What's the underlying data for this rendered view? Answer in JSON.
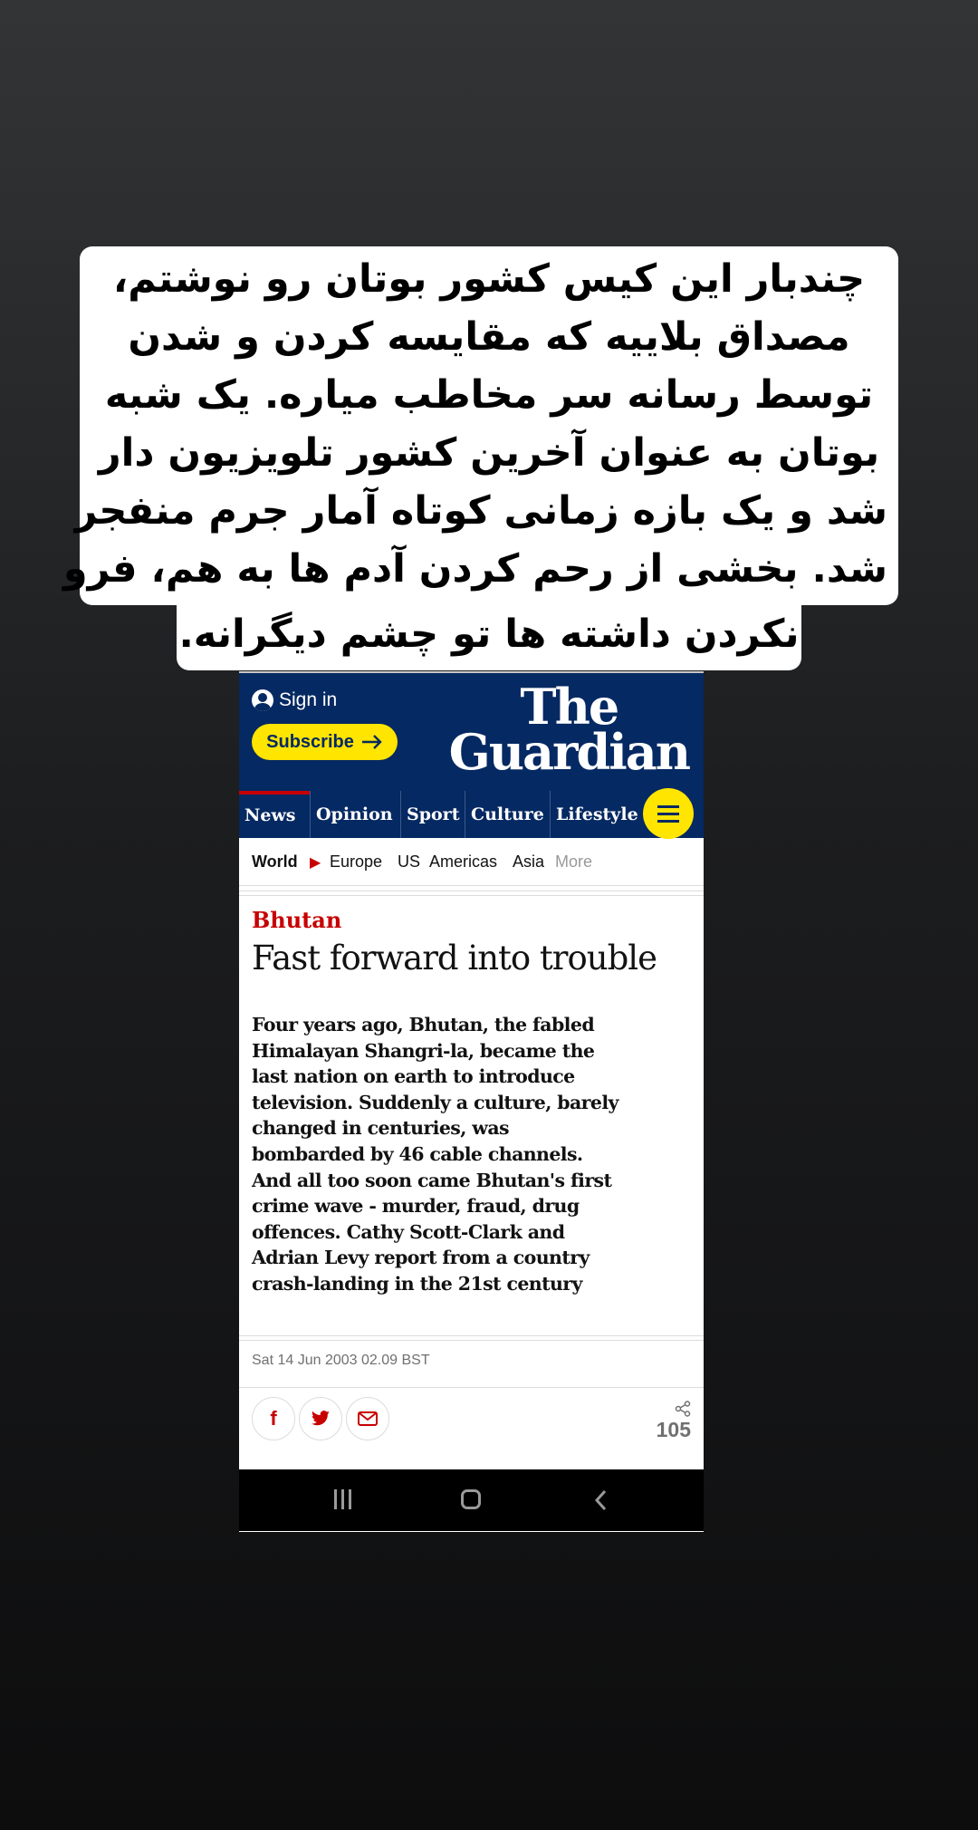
{
  "caption": {
    "lines": [
      "چندبار این کیس کشور بوتان رو نوشتم،",
      "مصداق بلاییه که مقایسه کردن و شدن",
      "توسط رسانه سر مخاطب میاره. یک شبه",
      "بوتان به عنوان آخرین کشور تلویزیون دار",
      "شد و یک بازه زمانی کوتاه آمار جرم منفجر",
      "شد. بخشی از رحم کردن آدم ها به هم، فرو",
      "نکردن داشته ها تو چشم دیگرانه."
    ]
  },
  "header": {
    "sign_in": "Sign in",
    "subscribe": "Subscribe",
    "logo_line1": "The",
    "logo_line2": "Guardian",
    "brand_color": "#052962",
    "accent_color": "#ffe500"
  },
  "nav": {
    "items": [
      "News",
      "Opinion",
      "Sport",
      "Culture",
      "Lifestyle"
    ],
    "menu_icon": "hamburger-icon"
  },
  "subnav": {
    "current": "World",
    "items": [
      "Europe",
      "US",
      "Americas",
      "Asia"
    ],
    "more": "More"
  },
  "article": {
    "kicker": "Bhutan",
    "headline": "Fast forward into trouble",
    "standfirst": "Four years ago, Bhutan, the fabled Himalayan Shangri-la, became the last nation on earth to introduce television. Suddenly a culture, barely changed in centuries, was bombarded by 46 cable channels. And all too soon came Bhutan's first crime wave - murder, fraud, drug offences. Cathy Scott-Clark and Adrian Levy report from a country crash-landing in the 21st century",
    "dateline": "Sat 14 Jun 2003 02.09 BST",
    "share_count": "105",
    "share_icons": [
      "facebook-icon",
      "twitter-icon",
      "email-icon"
    ]
  },
  "system_nav": {
    "buttons": [
      "recents-icon",
      "home-icon",
      "back-icon"
    ]
  }
}
